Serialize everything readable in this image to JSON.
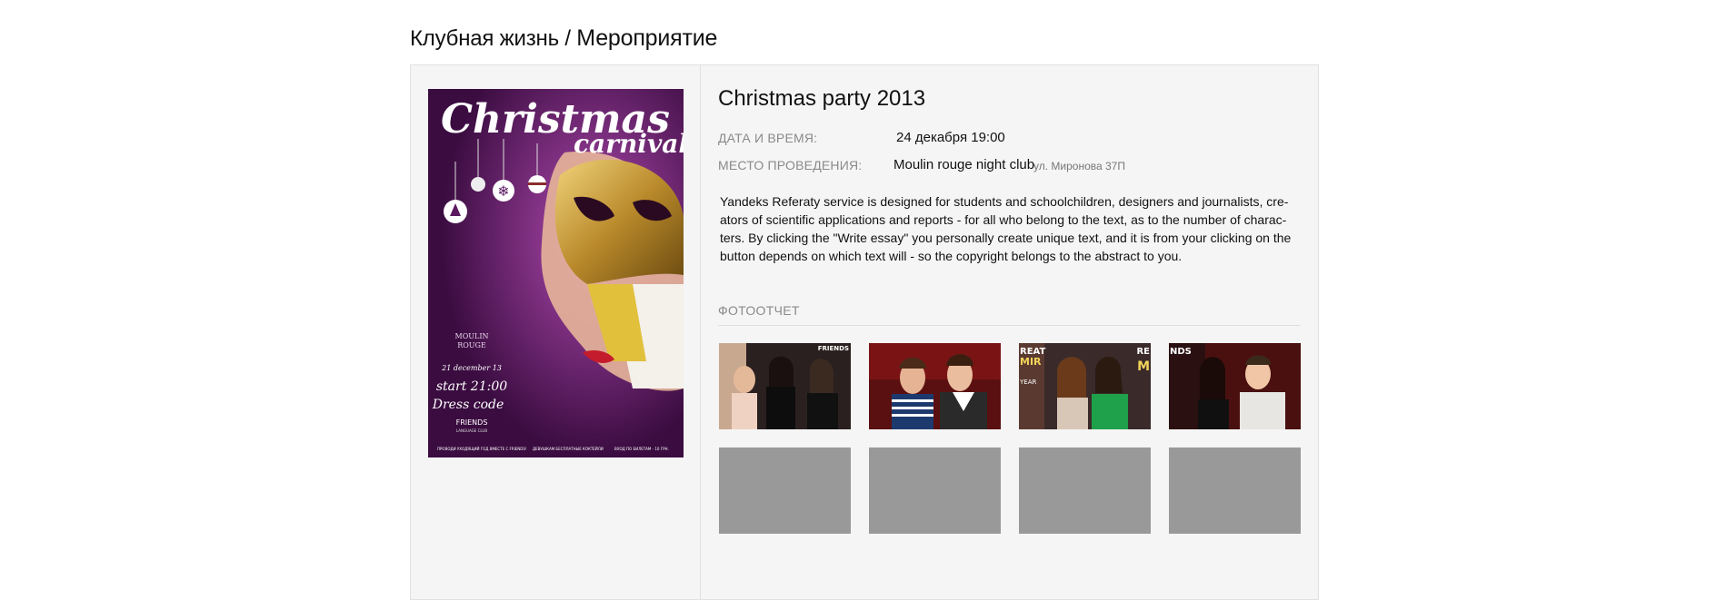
{
  "breadcrumb": {
    "parent": "Клубная жизнь",
    "separator": "/",
    "current": "Мероприятие"
  },
  "poster": {
    "headline_1": "Christmas",
    "headline_2": "carnival",
    "club_line_1": "MOULIN",
    "club_line_2": "ROUGE",
    "date": "21 december 13",
    "start": "start 21:00",
    "dress_code": "Dress code",
    "partner_1": "FRIENDS",
    "partner_2": "LANGUAGE CLUB",
    "footer_1": "ПРОВОДИ УХОДЯЩИЙ ГОД ВМЕСТЕ С FRIENDS!",
    "footer_2": "ДЕВУШКАМ БЕСПЛАТНЫЕ КОКТЕЙЛИ",
    "footer_3": "ВХОД ПО БИЛЕТАМ - 10 ГРН."
  },
  "event": {
    "title": "Christmas party 2013",
    "date_label": "ДАТА И ВРЕМЯ:",
    "date_value": "24 декабря 19:00",
    "place_label": "МЕСТО ПРОВЕДЕНИЯ:",
    "place_value": "Moulin rouge night club",
    "address": "ул. Миронова 37П",
    "description_lines": [
      "Yandeks Referaty service is designed for students and schoolchildren, designers and journalists, cre-",
      "ators of scientific applications and reports - for all who belong to the text, as to the number of charac-",
      "ters. By clicking the \"Write essay\" you personally create unique text, and it is from your clicking on the",
      "button depends on which text will - so the copyright belongs to the abstract to you."
    ]
  },
  "photos": {
    "heading": "ФОТООТЧЕТ",
    "thumbs": [
      {
        "overlay": "FRIENDS"
      },
      {
        "overlay": ""
      },
      {
        "overlay_left": "REAT",
        "overlay_left_2": "MIR",
        "overlay_left_3": "YEAR",
        "overlay_right": "RE",
        "overlay_right_2": "M"
      },
      {
        "overlay": "NDS"
      }
    ],
    "placeholder_color": "#999999"
  },
  "colors": {
    "panel_bg": "#f5f5f5",
    "panel_border": "#e1e1e1",
    "label_gray": "#8a8a8a",
    "poster_purple": "#5b1a60"
  }
}
